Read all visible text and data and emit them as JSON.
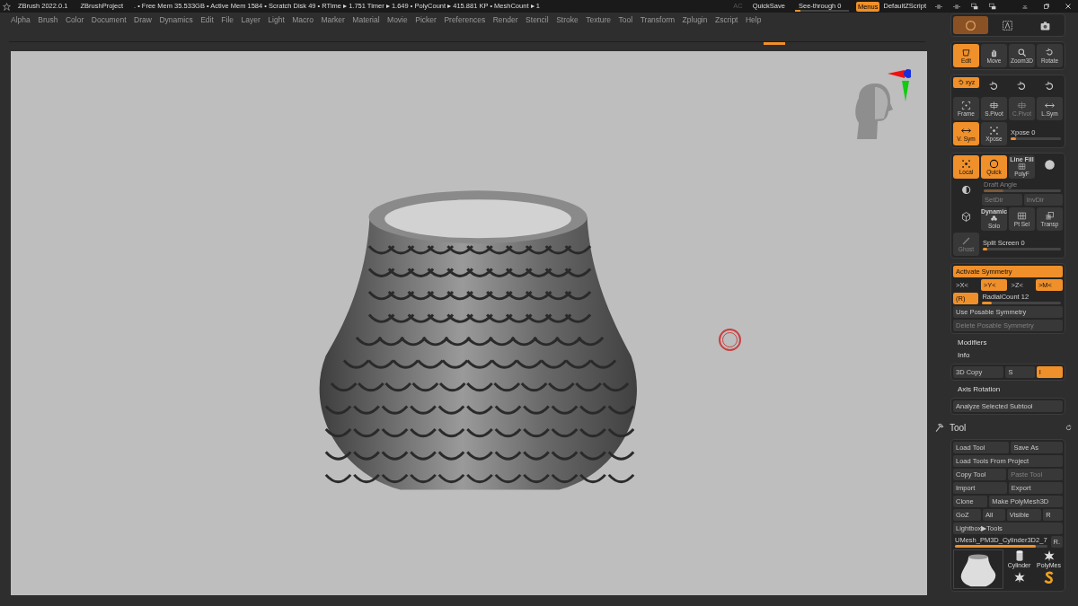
{
  "title_bar": {
    "app": "ZBrush 2022.0.1",
    "project": "ZBrushProject",
    "stats": ". • Free Mem 35.533GB • Active Mem 1584 • Scratch Disk 49 •  RTime ▸ 1.751 Timer ▸ 1.649 • PolyCount ▸ 415.881 KP  • MeshCount ▸ 1",
    "ac": "AC",
    "quicksave": "QuickSave",
    "see_through": {
      "label": "See-through  0",
      "level": 0.1
    },
    "menus": {
      "label": "Menus",
      "on": true
    },
    "script": "DefaultZScript"
  },
  "menu_bar": [
    "Alpha",
    "Brush",
    "Color",
    "Document",
    "Draw",
    "Dynamics",
    "Edit",
    "File",
    "Layer",
    "Light",
    "Macro",
    "Marker",
    "Material",
    "Movie",
    "Picker",
    "Preferences",
    "Render",
    "Stencil",
    "Stroke",
    "Texture",
    "Tool",
    "Transform",
    "Zplugin",
    "Zscript",
    "Help"
  ],
  "panel": [
    {
      "kind": "card",
      "rows": [
        {
          "items": [
            {
              "kind": "icon_only",
              "on": true
            },
            {
              "kind": "icon_only",
              "on": false
            },
            {
              "kind": "icon_only",
              "on": false
            }
          ]
        }
      ]
    },
    {
      "kind": "card",
      "rows": [
        {
          "items": [
            {
              "kind": "icon_button",
              "label": "Edit",
              "on": true
            },
            {
              "kind": "icon_button",
              "label": "Move",
              "on": false
            },
            {
              "kind": "icon_button",
              "label": "Zoom3D",
              "on": false
            },
            {
              "kind": "icon_button",
              "label": "Rotate",
              "on": false
            }
          ]
        }
      ]
    },
    {
      "kind": "card",
      "rows": [
        {
          "items": [
            {
              "kind": "inline_icon",
              "label": "xyz",
              "on": true
            },
            {
              "kind": "icon_only",
              "on": false
            },
            {
              "kind": "icon_only",
              "on": false
            },
            {
              "kind": "icon_only",
              "on": false
            }
          ]
        },
        {
          "items": [
            {
              "kind": "icon_button",
              "label": "Frame",
              "on": false
            },
            {
              "kind": "icon_button",
              "label": "S.Pivot",
              "on": false
            },
            {
              "kind": "icon_button",
              "label": "C.Pivot",
              "on": false,
              "disabled": true
            },
            {
              "kind": "icon_button",
              "label": "L.Sym",
              "on": false
            }
          ]
        },
        {
          "items": [
            {
              "kind": "icon_button",
              "label": "V. Sym",
              "on": true
            },
            {
              "kind": "icon_button",
              "label": "Xpose",
              "on": false
            },
            {
              "kind": "slider",
              "label": "Xpose 0",
              "level": 0.1
            }
          ]
        }
      ]
    },
    {
      "kind": "card",
      "rows": [
        {
          "items": [
            {
              "kind": "icon_button",
              "label": "Local",
              "on": true
            },
            {
              "kind": "icon_button",
              "label": "Quick",
              "on": true
            },
            {
              "kind": "caption_button",
              "caption": "Line Fill",
              "label": "PolyF",
              "on": false
            },
            {
              "kind": "icon_only",
              "on": false
            }
          ]
        },
        {
          "items": [
            {
              "kind": "icon_only",
              "on": false
            },
            {
              "kind": "group",
              "rows": [
                {
                  "items": [
                    {
                      "kind": "slider",
                      "label": "Draft Angle",
                      "level": 0.25,
                      "disabled": true
                    }
                  ]
                },
                {
                  "items": [
                    {
                      "kind": "button",
                      "label": "SetDir",
                      "on": false,
                      "disabled": true
                    },
                    {
                      "kind": "button",
                      "label": "InvDir",
                      "on": false,
                      "disabled": true
                    }
                  ]
                }
              ]
            }
          ]
        },
        {
          "items": [
            {
              "kind": "icon_only",
              "on": false
            },
            {
              "kind": "caption_button",
              "caption": "Dynamic",
              "label": "Solo",
              "on": false
            },
            {
              "kind": "icon_button",
              "label": "Pt Sel",
              "on": false
            },
            {
              "kind": "icon_button",
              "label": "Transp",
              "on": false
            }
          ]
        },
        {
          "items": [
            {
              "kind": "icon_button",
              "label": "Ghost",
              "on": false,
              "disabled": true
            },
            {
              "kind": "slider",
              "label": "Split Screen 0",
              "level": 0.06
            }
          ]
        }
      ]
    },
    {
      "kind": "card",
      "rows": [
        {
          "items": [
            {
              "kind": "button",
              "label": "Activate Symmetry",
              "on": true
            }
          ]
        },
        {
          "items": [
            {
              "kind": "toggle",
              "label": ">X<",
              "on": false
            },
            {
              "kind": "toggle",
              "label": ">Y<",
              "on": true
            },
            {
              "kind": "toggle",
              "label": ">Z<",
              "on": false
            },
            {
              "kind": "toggle",
              "label": ">M<",
              "on": true
            }
          ]
        },
        {
          "items": [
            {
              "kind": "toggle",
              "label": "(R)",
              "on": true
            },
            {
              "kind": "slider",
              "label": "RadialCount 12",
              "level": 0.12
            }
          ]
        },
        {
          "items": [
            {
              "kind": "button",
              "label": "Use Posable Symmetry",
              "on": false
            }
          ]
        },
        {
          "items": [
            {
              "kind": "button",
              "label": "Delete Posable Symmetry",
              "on": false,
              "disabled": true
            }
          ]
        }
      ]
    },
    {
      "kind": "header",
      "label": "Modifiers"
    },
    {
      "kind": "header",
      "label": "Info"
    },
    {
      "kind": "card",
      "rows": [
        {
          "items": [
            {
              "kind": "button",
              "label": "3D Copy",
              "on": false
            },
            {
              "kind": "button",
              "label": "S",
              "on": false
            },
            {
              "kind": "toggle",
              "label": "I",
              "on": true
            }
          ]
        }
      ]
    },
    {
      "kind": "header",
      "label": "Axis Rotation"
    },
    {
      "kind": "card",
      "rows": [
        {
          "items": [
            {
              "kind": "button",
              "label": "Analyze Selected Subtool",
              "on": false
            }
          ]
        }
      ]
    },
    {
      "kind": "palette_header",
      "label": "Tool"
    },
    {
      "kind": "card",
      "rows": [
        {
          "items": [
            {
              "kind": "button",
              "label": "Load Tool",
              "on": false
            },
            {
              "kind": "button",
              "label": "Save As",
              "on": false
            }
          ]
        },
        {
          "items": [
            {
              "kind": "button",
              "label": "Load Tools From Project",
              "on": false
            }
          ]
        },
        {
          "items": [
            {
              "kind": "button",
              "label": "Copy Tool",
              "on": false
            },
            {
              "kind": "button",
              "label": "Paste Tool",
              "on": false,
              "disabled": true
            }
          ]
        },
        {
          "items": [
            {
              "kind": "button",
              "label": "Import",
              "on": false
            },
            {
              "kind": "button",
              "label": "Export",
              "on": false
            }
          ]
        },
        {
          "items": [
            {
              "kind": "button",
              "label": "Clone",
              "on": false
            },
            {
              "kind": "button",
              "label": "Make PolyMesh3D",
              "on": false
            }
          ]
        },
        {
          "items": [
            {
              "kind": "button",
              "label": "GoZ",
              "on": false
            },
            {
              "kind": "button",
              "label": "All",
              "on": false
            },
            {
              "kind": "button",
              "label": "Visible",
              "on": false
            },
            {
              "kind": "button",
              "label": "R",
              "on": false
            }
          ]
        },
        {
          "items": [
            {
              "kind": "button",
              "label": "Lightbox▶Tools",
              "on": false
            }
          ]
        },
        {
          "items": [
            {
              "kind": "slider",
              "label": "UMesh_PM3D_Cylinder3D2_7",
              "level": 0.88
            },
            {
              "kind": "button",
              "label": "R.",
              "on": false
            }
          ]
        },
        {
          "items": [
            {
              "kind": "thumb_large"
            },
            {
              "kind": "group",
              "rows": [
                {
                  "items": [
                    {
                      "kind": "thumb",
                      "label": "Cylinder"
                    },
                    {
                      "kind": "thumb",
                      "label": "PolyMes"
                    }
                  ]
                },
                {
                  "items": [
                    {
                      "kind": "thumb"
                    },
                    {
                      "kind": "thumb"
                    }
                  ]
                }
              ]
            }
          ]
        }
      ]
    }
  ]
}
